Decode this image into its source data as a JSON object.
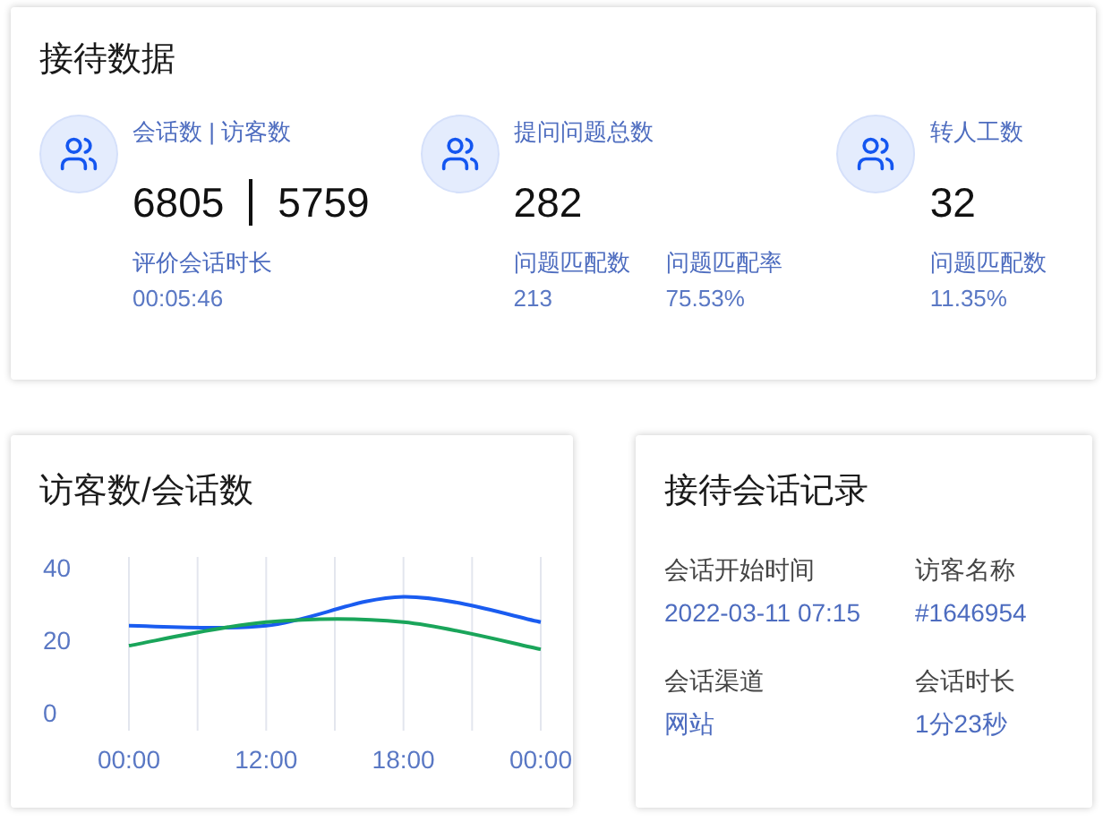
{
  "reception": {
    "title": "接待数据",
    "stats": [
      {
        "label": "会话数 | 访客数",
        "values": [
          "6805",
          "5759"
        ],
        "details": [
          {
            "label": "评价会话时长",
            "value": "00:05:46"
          }
        ]
      },
      {
        "label": "提问问题总数",
        "values": [
          "282"
        ],
        "details": [
          {
            "label": "问题匹配数",
            "value": "213"
          },
          {
            "label": "问题匹配率",
            "value": "75.53%"
          }
        ]
      },
      {
        "label": "转人工数",
        "values": [
          "32"
        ],
        "details": [
          {
            "label": "问题匹配数",
            "value": "11.35%"
          }
        ]
      }
    ]
  },
  "trend": {
    "title": "访客数/会话数",
    "chart_data": {
      "type": "line",
      "grid": true,
      "categories": [
        "00:00",
        "12:00",
        "18:00",
        "00:00"
      ],
      "ylim": [
        0,
        40
      ],
      "yticks": [
        0,
        20,
        40
      ],
      "series": [
        {
          "color": "#1a5cf0",
          "values": [
            24,
            24,
            32,
            25
          ]
        },
        {
          "color": "#1aa55a",
          "values": [
            18.5,
            25,
            25,
            17.5
          ]
        }
      ]
    }
  },
  "record": {
    "title": "接待会话记录",
    "fields": [
      {
        "label": "会话开始时间",
        "value": "2022-03-11 07:15"
      },
      {
        "label": "访客名称",
        "value": "#1646954"
      },
      {
        "label": "会话渠道",
        "value": "网站"
      },
      {
        "label": "会话时长",
        "value": "1分23秒"
      }
    ]
  }
}
